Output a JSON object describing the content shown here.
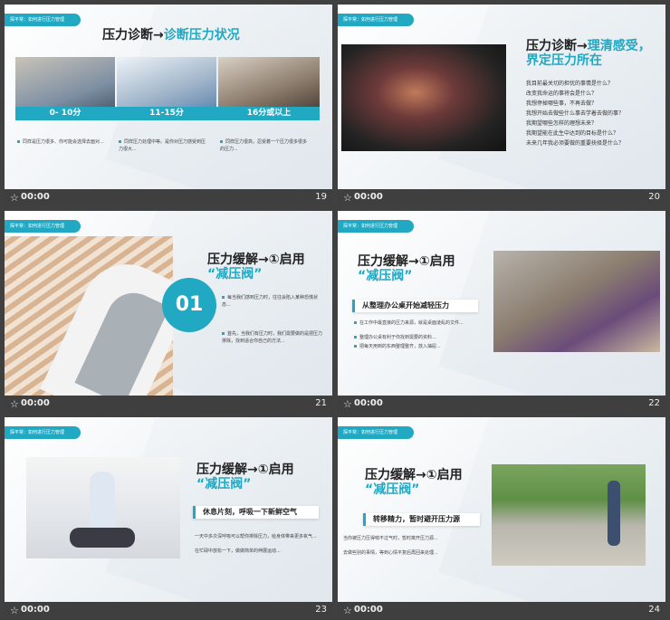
{
  "common": {
    "tag": "探平常：如何进行压力管理",
    "time": "00:00"
  },
  "slides": [
    {
      "number": "19",
      "title_a": "压力诊断→",
      "title_b": "诊断压力状况",
      "bands": [
        "0- 10分",
        "11-15分",
        "16分或以上"
      ],
      "notes": [
        "同样是压力很多、你可能会选择去面对...",
        "同样压力处理中等。是你对压力感受到压力很大...",
        "同样压力很高，忍受着一个压力很多很多的压力..."
      ]
    },
    {
      "number": "20",
      "title_a": "压力诊断→",
      "title_b": "理清感受，",
      "title_c": "界定压力所在",
      "questions": [
        "我目前最关切的担忧的事情是什么？",
        "改变我命运的事将会是什么？",
        "我想停掉哪些事，不再去做？",
        "我想开始去做些什么事去学着去做的事？",
        "我期望哪些怎样的理想未来？",
        "我期望能在此生中达到的目标是什么？",
        "未来几年我必须要做的重要抉择是什么？"
      ]
    },
    {
      "number": "21",
      "title_a": "压力缓解→①启用",
      "title_b": "“减压阀”",
      "circle": "01",
      "notes": [
        "每当我们感到压力时，往往会陷入某种恐慌状态...",
        "首先，当我们有压力时，我们需要做的是把压力排除，找到适合你自己的方法..."
      ]
    },
    {
      "number": "22",
      "title_a": "压力缓解→①启用",
      "title_b": "“减压阀”",
      "subtitle": "从整理办公桌开始减轻压力",
      "notes": [
        "在工作中最直接的压力来源，就是桌面凌乱的文件...",
        "整理办公桌有利于你找到需要的资料...",
        "把每天用到的东西整理整齐，放入抽屉..."
      ]
    },
    {
      "number": "23",
      "title_a": "压力缓解→①启用",
      "title_b": "“减压阀”",
      "subtitle": "休息片刻，呼吸一下新鲜空气",
      "notes": [
        "一天中多次深呼吸可以帮你排除压力，给身体带来更多氧气...",
        "在忙碌中放松一下，做做简单的伸展运动..."
      ]
    },
    {
      "number": "24",
      "title_a": "压力缓解→①启用",
      "title_b": "“减压阀”",
      "subtitle": "转移精力，暂时避开压力源",
      "notes": [
        "当你被压力压得喘不过气时，暂时离开压力源...",
        "去做些别的事情，等到心情平复后再回来处理..."
      ]
    }
  ]
}
